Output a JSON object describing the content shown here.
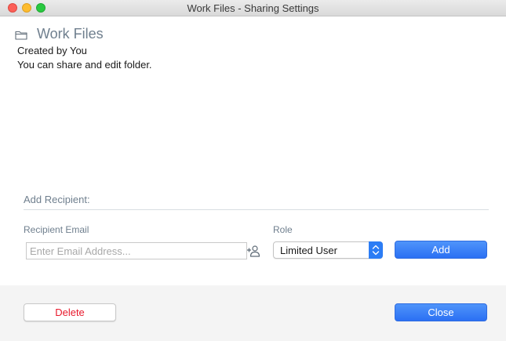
{
  "window": {
    "title": "Work Files - Sharing Settings"
  },
  "folder": {
    "name": "Work Files",
    "created_by": "Created by You",
    "permission_text": "You can share and edit folder."
  },
  "add_recipient": {
    "section_label": "Add Recipient:",
    "email_label": "Recipient Email",
    "email_placeholder": "Enter Email Address...",
    "email_value": "",
    "role_label": "Role",
    "role_value": "Limited User",
    "add_button": "Add"
  },
  "footer": {
    "delete_button": "Delete",
    "close_button": "Close"
  },
  "colors": {
    "accent": "#2b70f3",
    "danger": "#e8192c",
    "muted_label": "#6f7f8e"
  },
  "icons": {
    "folder": "folder-icon",
    "add_contact": "add-contact-icon",
    "stepper": "chevron-up-down-icon"
  }
}
